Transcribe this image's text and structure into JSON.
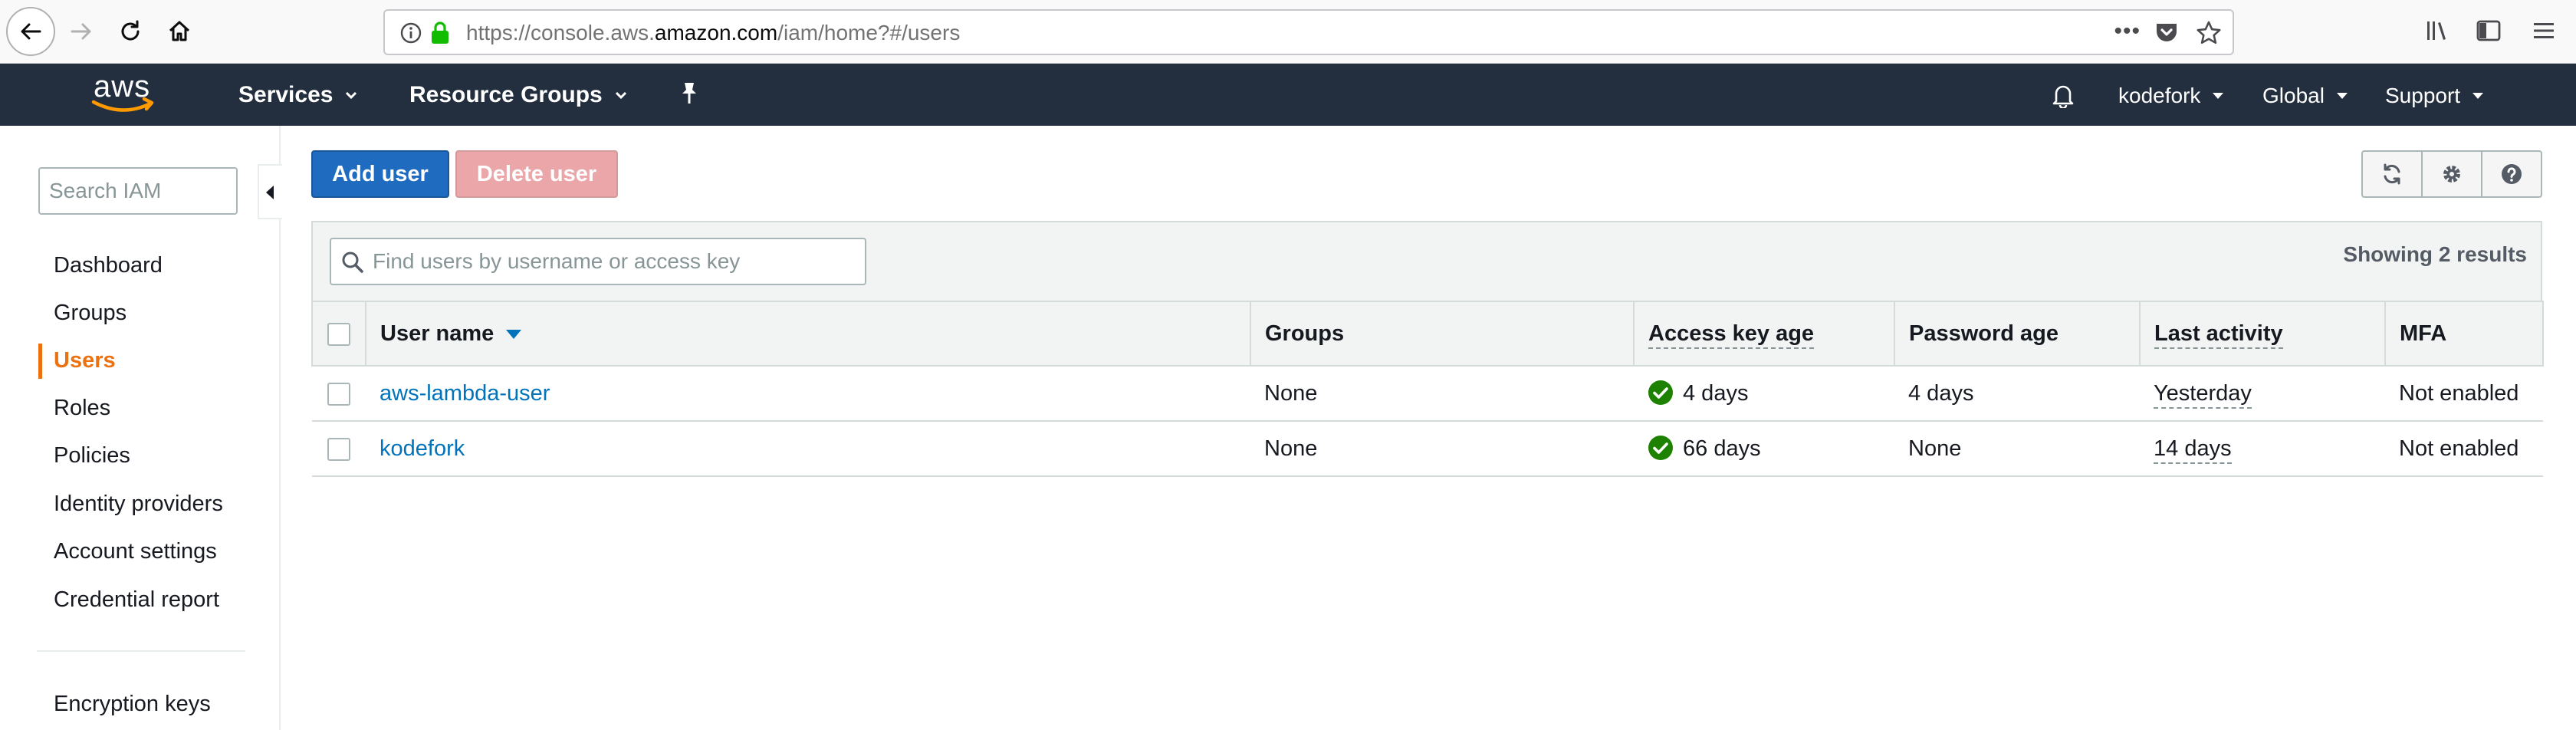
{
  "browser": {
    "url_prefix": "https://console.aws.",
    "url_host": "amazon.com",
    "url_path": "/iam/home?#/users",
    "url_more": "•••"
  },
  "aws_nav": {
    "logo_text": "aws",
    "services": "Services",
    "resource_groups": "Resource Groups",
    "account": "kodefork",
    "region": "Global",
    "support": "Support"
  },
  "sidebar": {
    "search_placeholder": "Search IAM",
    "items": [
      "Dashboard",
      "Groups",
      "Users",
      "Roles",
      "Policies",
      "Identity providers",
      "Account settings",
      "Credential report"
    ],
    "active_item": "Users",
    "footer_item": "Encryption keys"
  },
  "toolbar": {
    "add_user": "Add user",
    "delete_user": "Delete user"
  },
  "filter": {
    "placeholder": "Find users by username or access key",
    "results": "Showing 2 results"
  },
  "table": {
    "columns": [
      "User name",
      "Groups",
      "Access key age",
      "Password age",
      "Last activity",
      "MFA"
    ],
    "rows": [
      {
        "user": "aws-lambda-user",
        "groups": "None",
        "access_key_age": "4 days",
        "password_age": "4 days",
        "last_activity": "Yesterday",
        "mfa": "Not enabled"
      },
      {
        "user": "kodefork",
        "groups": "None",
        "access_key_age": "66 days",
        "password_age": "None",
        "last_activity": "14 days",
        "mfa": "Not enabled"
      }
    ]
  },
  "colors": {
    "nav_bg": "#232f3e",
    "primary_button": "#1f6bbf",
    "disabled_danger_button": "#eaa6a9",
    "active_nav": "#ec7211",
    "link": "#0073bb",
    "status_ok": "#1d8102"
  },
  "icons": [
    "back-icon",
    "forward-icon",
    "reload-icon",
    "home-icon",
    "info-icon",
    "lock-icon",
    "pocket-icon",
    "star-icon",
    "library-icon",
    "sidebar-icon",
    "menu-icon",
    "aws-smile-logo",
    "pin-icon",
    "bell-icon",
    "refresh-icon",
    "gear-icon",
    "help-icon",
    "search-icon",
    "sort-down-icon",
    "check-circle-icon"
  ]
}
